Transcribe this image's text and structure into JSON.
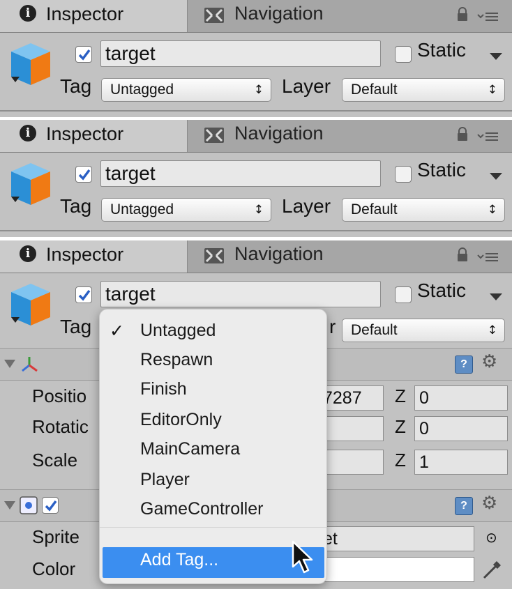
{
  "tabs": {
    "inspector": "Inspector",
    "navigation": "Navigation"
  },
  "object": {
    "name": "target",
    "static_label": "Static",
    "tag_label": "Tag",
    "tag_value": "Untagged",
    "layer_label": "Layer",
    "layer_value": "Default"
  },
  "popup_arrow": "↕",
  "transform": {
    "rows": [
      {
        "label": "Position",
        "label_visible": "Positio",
        "x_partial": "7287",
        "z_label": "Z",
        "z_value": "0"
      },
      {
        "label": "Rotation",
        "label_visible": "Rotatic",
        "z_label": "Z",
        "z_value": "0"
      },
      {
        "label": "Scale",
        "label_visible": "Scale",
        "z_label": "Z",
        "z_value": "1"
      }
    ]
  },
  "sprite_renderer": {
    "sprite_label": "Sprite",
    "sprite_value_partial": "et",
    "color_label": "Color"
  },
  "tag_menu": {
    "items": [
      "Untagged",
      "Respawn",
      "Finish",
      "EditorOnly",
      "MainCamera",
      "Player",
      "GameController"
    ],
    "selected": "Untagged",
    "check": "✓",
    "add_tag": "Add Tag..."
  },
  "colors": {
    "panel_bg": "#c2c2c2",
    "tab_active": "#cbcbcb",
    "highlight": "#3b8ef0",
    "checkbox_blue": "#2a5fc4"
  },
  "icons": {
    "info": "info-icon",
    "navigation": "navigation-icon",
    "lock": "lock-icon",
    "menu": "menu-icon",
    "gear": "gear-icon",
    "help": "help-icon",
    "eyedropper": "eyedropper-icon"
  }
}
